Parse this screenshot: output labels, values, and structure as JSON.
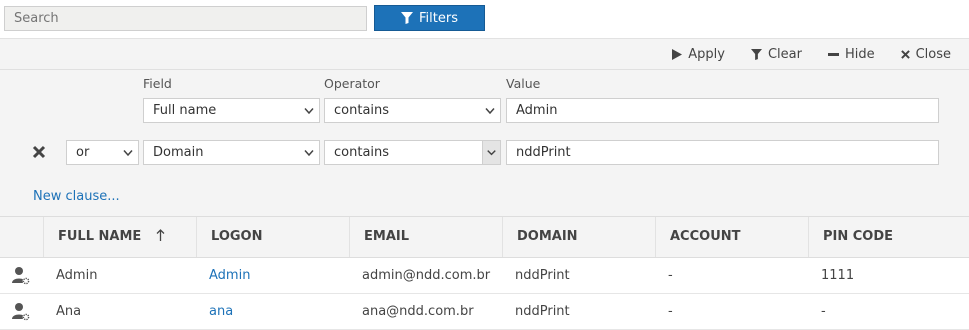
{
  "search": {
    "placeholder": "Search"
  },
  "filters_button": {
    "label": "Filters"
  },
  "panel_actions": [
    {
      "label": "Apply",
      "icon": "play-icon"
    },
    {
      "label": "Clear",
      "icon": "filter-icon"
    },
    {
      "label": "Hide",
      "icon": "minus-icon"
    },
    {
      "label": "Close",
      "icon": "close-icon"
    }
  ],
  "filter_columns": {
    "field": "Field",
    "operator": "Operator",
    "value": "Value"
  },
  "clauses": [
    {
      "field": "Full name",
      "operator": "contains",
      "value": "Admin"
    },
    {
      "conjunction": "or",
      "field": "Domain",
      "operator": "contains",
      "value": "nddPrint"
    }
  ],
  "new_clause": "New clause...",
  "table": {
    "columns": [
      "FULL NAME",
      "LOGON",
      "EMAIL",
      "DOMAIN",
      "ACCOUNT",
      "PIN CODE"
    ],
    "sort_column": "FULL NAME",
    "sort_direction": "ascending",
    "rows": [
      {
        "full_name": "Admin",
        "logon": "Admin",
        "email": "admin@ndd.com.br",
        "domain": "nddPrint",
        "account": "-",
        "pin_code": "1111"
      },
      {
        "full_name": "Ana",
        "logon": "ana",
        "email": "ana@ndd.com.br",
        "domain": "nddPrint",
        "account": "-",
        "pin_code": "-"
      }
    ]
  },
  "colors": {
    "accent": "#1d72b8",
    "panel_bg": "#f4f4f4"
  }
}
